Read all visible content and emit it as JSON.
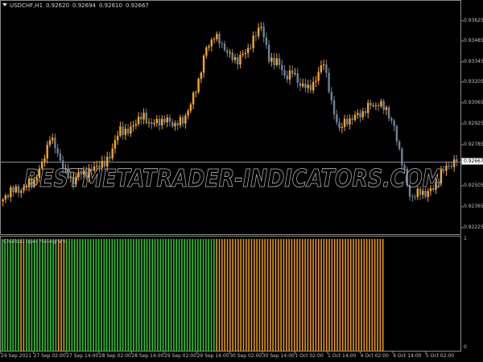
{
  "header": {
    "symbol": "USDCHF,H1",
    "open": "0.92620",
    "high": "0.92694",
    "low": "0.92610",
    "close": "0.92667"
  },
  "indicator": {
    "label": "Chaikou oper histogram",
    "scale_top": "1",
    "scale_bottom": "0",
    "segments": [
      {
        "color": "green",
        "count": 7
      },
      {
        "color": "orange",
        "count": 2
      },
      {
        "color": "green",
        "count": 12
      },
      {
        "color": "orange",
        "count": 3
      },
      {
        "color": "green",
        "count": 56
      },
      {
        "color": "orange",
        "count": 63
      }
    ]
  },
  "watermark": "BESTMETATRADER-INDICATORS.COM",
  "price_axis": [
    "0.93625",
    "0.93485",
    "0.93345",
    "0.93205",
    "0.93065",
    "0.92925",
    "0.92785",
    "0.92505",
    "0.92365",
    "0.92225"
  ],
  "current_price": "0.92667",
  "time_axis": [
    "24 Sep 2021",
    "27 Sep 02:00",
    "27 Sep 14:00",
    "28 Sep 02:00",
    "28 Sep 14:00",
    "29 Sep 02:00",
    "29 Sep 14:00",
    "30 Sep 02:00",
    "30 Sep 14:00",
    "1 Oct 02:00",
    "1 Oct 14:00",
    "4 Oct 02:00",
    "4 Oct 14:00",
    "5 Oct 02:00"
  ],
  "colors": {
    "bull": "#f5a623",
    "bear": "#6f8298",
    "hist_green": "#2ec82e",
    "hist_orange": "#e8980f",
    "price_line": "#7f8fa0"
  },
  "price_path": [
    0.92399,
    0.92481,
    0.92465,
    0.92508,
    0.92536,
    0.92645,
    0.92835,
    0.92726,
    0.9259,
    0.92536,
    0.9259,
    0.9259,
    0.92645,
    0.92645,
    0.92753,
    0.9289,
    0.92862,
    0.92944,
    0.92971,
    0.92917,
    0.92944,
    0.92944,
    0.92917,
    0.92944,
    0.93053,
    0.93217,
    0.93434,
    0.93516,
    0.93462,
    0.9338,
    0.93353,
    0.93407,
    0.93489,
    0.93598,
    0.93353,
    0.93353,
    0.93244,
    0.93271,
    0.93189,
    0.93162,
    0.93217,
    0.93353,
    0.93053,
    0.9289,
    0.92944,
    0.92971,
    0.92999,
    0.93053,
    0.93053,
    0.93026,
    0.9289,
    0.92672,
    0.92427,
    0.92454,
    0.92454,
    0.92481,
    0.9259,
    0.92645,
    0.92667
  ]
}
